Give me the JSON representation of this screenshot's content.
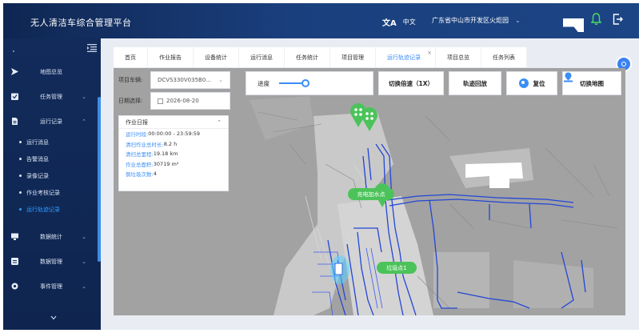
{
  "header": {
    "title": "无人清洁车综合管理平台",
    "lang_icon": "文A",
    "lang_label": "中文",
    "region": "广东省中山市开发区火炬园",
    "region_chevron": "⌄",
    "icons": [
      "bell-icon",
      "exit-icon"
    ]
  },
  "sidebar": {
    "menu": [
      {
        "label": "地图总览",
        "icon": "send-icon",
        "chevron": ""
      },
      {
        "label": "任务管理",
        "icon": "task-icon",
        "chevron": "⌄"
      },
      {
        "label": "运行记录",
        "icon": "file-icon",
        "chevron": "⌃"
      }
    ],
    "submenu": [
      {
        "label": "运行消息"
      },
      {
        "label": "告警消息"
      },
      {
        "label": "录像记录"
      },
      {
        "label": "作业考核记录"
      },
      {
        "label": "运行轨迹记录"
      }
    ],
    "menu2": [
      {
        "label": "数据统计",
        "icon": "monitor-icon",
        "chevron": "⌄"
      },
      {
        "label": "数据管理",
        "icon": "database-icon",
        "chevron": "⌄"
      },
      {
        "label": "事件管理",
        "icon": "event-icon",
        "chevron": "⌄"
      }
    ]
  },
  "tabs": [
    {
      "label": "首页"
    },
    {
      "label": "作业报告"
    },
    {
      "label": "设备统计"
    },
    {
      "label": "运行消息"
    },
    {
      "label": "任务统计"
    },
    {
      "label": "项目管理"
    },
    {
      "label": "运行轨迹记录",
      "close": "×"
    },
    {
      "label": "项目总览"
    },
    {
      "label": "任务列表"
    }
  ],
  "filters": {
    "vehicle_label": "项目车辆:",
    "vehicle_value": "DCVS330V035B0...",
    "date_label": "日期选择:",
    "date_value": "2026-08-20"
  },
  "daily_report": {
    "title": "作业日报",
    "rows": [
      {
        "k": "运行时段:",
        "v": " 00:00:00 - 23:59:59"
      },
      {
        "k": "清扫作业总时长:",
        "v": " 8.2 h"
      },
      {
        "k": "清扫总里程:",
        "v": " 19.18 km"
      },
      {
        "k": "作业总面积:",
        "v": " 30719 m²"
      },
      {
        "k": "倒垃圾次数:",
        "v": " 4"
      }
    ]
  },
  "toolbar": {
    "progress_label": "进度",
    "progress_value": 0.55,
    "speed_button": "切换倍速（1X）",
    "playback_button": "轨迹回放",
    "reset_button": "复位",
    "switch_map_button": "切换地图"
  },
  "map": {
    "labels": {
      "charge": "充电加水点",
      "trash": "垃圾点1"
    }
  },
  "colors": {
    "accent": "#3a8ef6",
    "marker_green": "#4cc35a",
    "header_dark": "#0f2652"
  }
}
